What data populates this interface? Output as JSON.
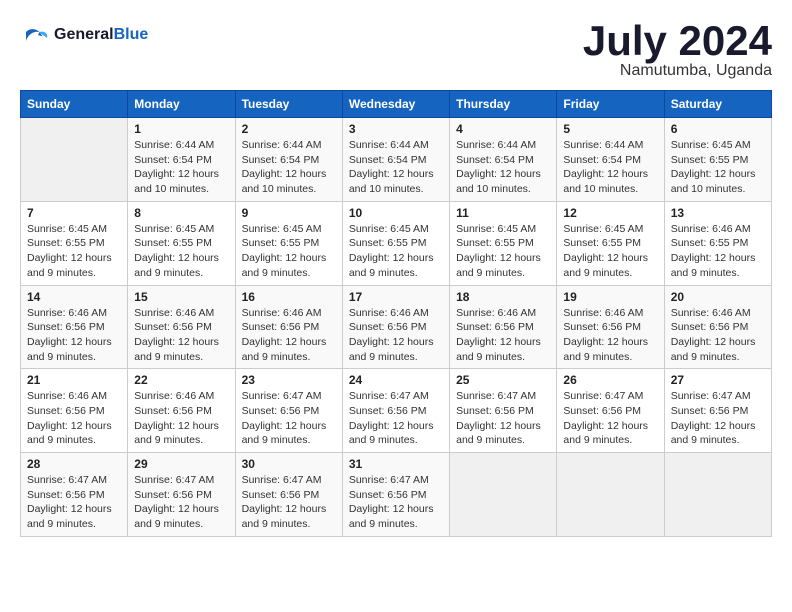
{
  "header": {
    "logo_line1": "General",
    "logo_line2": "Blue",
    "month": "July 2024",
    "location": "Namutumba, Uganda"
  },
  "days_of_week": [
    "Sunday",
    "Monday",
    "Tuesday",
    "Wednesday",
    "Thursday",
    "Friday",
    "Saturday"
  ],
  "weeks": [
    [
      {
        "day": "",
        "info": ""
      },
      {
        "day": "1",
        "info": "Sunrise: 6:44 AM\nSunset: 6:54 PM\nDaylight: 12 hours\nand 10 minutes."
      },
      {
        "day": "2",
        "info": "Sunrise: 6:44 AM\nSunset: 6:54 PM\nDaylight: 12 hours\nand 10 minutes."
      },
      {
        "day": "3",
        "info": "Sunrise: 6:44 AM\nSunset: 6:54 PM\nDaylight: 12 hours\nand 10 minutes."
      },
      {
        "day": "4",
        "info": "Sunrise: 6:44 AM\nSunset: 6:54 PM\nDaylight: 12 hours\nand 10 minutes."
      },
      {
        "day": "5",
        "info": "Sunrise: 6:44 AM\nSunset: 6:54 PM\nDaylight: 12 hours\nand 10 minutes."
      },
      {
        "day": "6",
        "info": "Sunrise: 6:45 AM\nSunset: 6:55 PM\nDaylight: 12 hours\nand 10 minutes."
      }
    ],
    [
      {
        "day": "7",
        "info": "Sunrise: 6:45 AM\nSunset: 6:55 PM\nDaylight: 12 hours\nand 9 minutes."
      },
      {
        "day": "8",
        "info": "Sunrise: 6:45 AM\nSunset: 6:55 PM\nDaylight: 12 hours\nand 9 minutes."
      },
      {
        "day": "9",
        "info": "Sunrise: 6:45 AM\nSunset: 6:55 PM\nDaylight: 12 hours\nand 9 minutes."
      },
      {
        "day": "10",
        "info": "Sunrise: 6:45 AM\nSunset: 6:55 PM\nDaylight: 12 hours\nand 9 minutes."
      },
      {
        "day": "11",
        "info": "Sunrise: 6:45 AM\nSunset: 6:55 PM\nDaylight: 12 hours\nand 9 minutes."
      },
      {
        "day": "12",
        "info": "Sunrise: 6:45 AM\nSunset: 6:55 PM\nDaylight: 12 hours\nand 9 minutes."
      },
      {
        "day": "13",
        "info": "Sunrise: 6:46 AM\nSunset: 6:55 PM\nDaylight: 12 hours\nand 9 minutes."
      }
    ],
    [
      {
        "day": "14",
        "info": "Sunrise: 6:46 AM\nSunset: 6:56 PM\nDaylight: 12 hours\nand 9 minutes."
      },
      {
        "day": "15",
        "info": "Sunrise: 6:46 AM\nSunset: 6:56 PM\nDaylight: 12 hours\nand 9 minutes."
      },
      {
        "day": "16",
        "info": "Sunrise: 6:46 AM\nSunset: 6:56 PM\nDaylight: 12 hours\nand 9 minutes."
      },
      {
        "day": "17",
        "info": "Sunrise: 6:46 AM\nSunset: 6:56 PM\nDaylight: 12 hours\nand 9 minutes."
      },
      {
        "day": "18",
        "info": "Sunrise: 6:46 AM\nSunset: 6:56 PM\nDaylight: 12 hours\nand 9 minutes."
      },
      {
        "day": "19",
        "info": "Sunrise: 6:46 AM\nSunset: 6:56 PM\nDaylight: 12 hours\nand 9 minutes."
      },
      {
        "day": "20",
        "info": "Sunrise: 6:46 AM\nSunset: 6:56 PM\nDaylight: 12 hours\nand 9 minutes."
      }
    ],
    [
      {
        "day": "21",
        "info": "Sunrise: 6:46 AM\nSunset: 6:56 PM\nDaylight: 12 hours\nand 9 minutes."
      },
      {
        "day": "22",
        "info": "Sunrise: 6:46 AM\nSunset: 6:56 PM\nDaylight: 12 hours\nand 9 minutes."
      },
      {
        "day": "23",
        "info": "Sunrise: 6:47 AM\nSunset: 6:56 PM\nDaylight: 12 hours\nand 9 minutes."
      },
      {
        "day": "24",
        "info": "Sunrise: 6:47 AM\nSunset: 6:56 PM\nDaylight: 12 hours\nand 9 minutes."
      },
      {
        "day": "25",
        "info": "Sunrise: 6:47 AM\nSunset: 6:56 PM\nDaylight: 12 hours\nand 9 minutes."
      },
      {
        "day": "26",
        "info": "Sunrise: 6:47 AM\nSunset: 6:56 PM\nDaylight: 12 hours\nand 9 minutes."
      },
      {
        "day": "27",
        "info": "Sunrise: 6:47 AM\nSunset: 6:56 PM\nDaylight: 12 hours\nand 9 minutes."
      }
    ],
    [
      {
        "day": "28",
        "info": "Sunrise: 6:47 AM\nSunset: 6:56 PM\nDaylight: 12 hours\nand 9 minutes."
      },
      {
        "day": "29",
        "info": "Sunrise: 6:47 AM\nSunset: 6:56 PM\nDaylight: 12 hours\nand 9 minutes."
      },
      {
        "day": "30",
        "info": "Sunrise: 6:47 AM\nSunset: 6:56 PM\nDaylight: 12 hours\nand 9 minutes."
      },
      {
        "day": "31",
        "info": "Sunrise: 6:47 AM\nSunset: 6:56 PM\nDaylight: 12 hours\nand 9 minutes."
      },
      {
        "day": "",
        "info": ""
      },
      {
        "day": "",
        "info": ""
      },
      {
        "day": "",
        "info": ""
      }
    ]
  ]
}
